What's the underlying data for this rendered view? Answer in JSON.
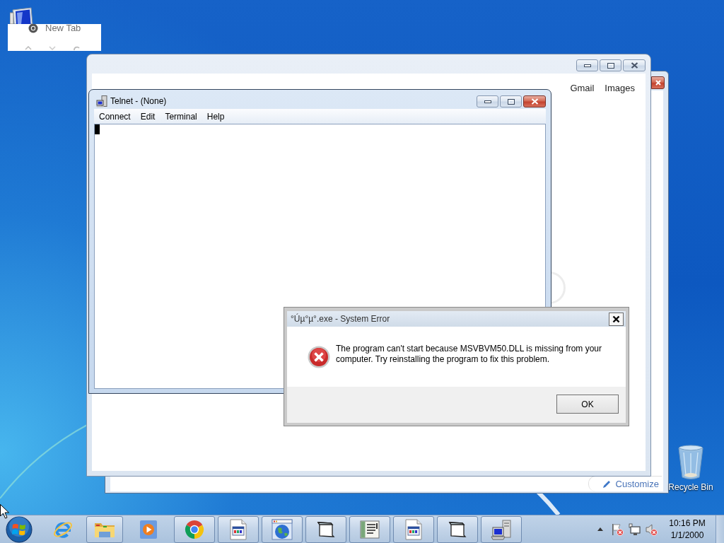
{
  "desktop_icons": [
    {
      "kind": "computer"
    },
    {
      "kind": "recycle_bin",
      "label": "Recycle Bin"
    }
  ],
  "tab_preview": {
    "title": "New Tab"
  },
  "background_window": {
    "button": "Customize"
  },
  "browser_window": {
    "active": false,
    "links": [
      "Gmail",
      "Images"
    ]
  },
  "telnet_window": {
    "title": "Telnet - (None)",
    "active": true,
    "menu": [
      "Connect",
      "Edit",
      "Terminal",
      "Help"
    ]
  },
  "error_dialog": {
    "title": "°Úµ°µ°.exe - System Error",
    "message": "The program can't start because MSVBVM50.DLL is missing from your computer. Try reinstalling the program to fix this problem.",
    "button": "OK"
  },
  "taskbar": {
    "items": [
      {
        "kind": "ie",
        "running": false
      },
      {
        "kind": "explorer",
        "running": true
      },
      {
        "kind": "media_player",
        "running": false
      },
      {
        "kind": "chrome",
        "running": true
      },
      {
        "kind": "app_document",
        "running": true
      },
      {
        "kind": "globe",
        "running": true
      },
      {
        "kind": "folder",
        "running": true
      },
      {
        "kind": "list_document",
        "running": true
      },
      {
        "kind": "app_document",
        "running": true
      },
      {
        "kind": "folder",
        "running": true
      },
      {
        "kind": "computer",
        "running": true
      }
    ],
    "tray": [
      {
        "kind": "flag",
        "alert": true
      },
      {
        "kind": "network",
        "alert": false
      },
      {
        "kind": "speaker",
        "alert": true
      }
    ],
    "clock": {
      "time": "10:16 PM",
      "date": "1/1/2000"
    }
  }
}
